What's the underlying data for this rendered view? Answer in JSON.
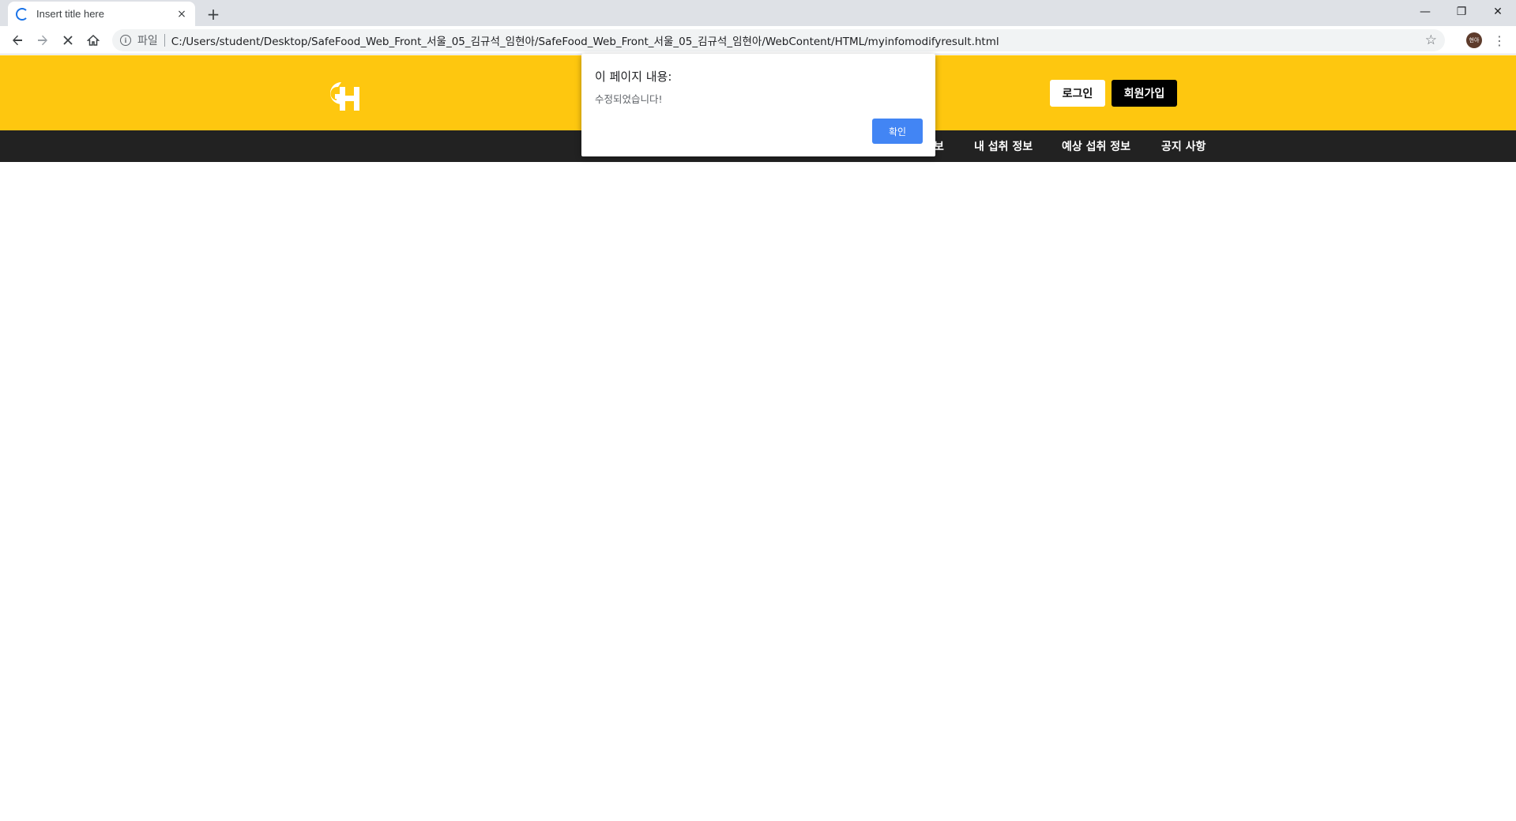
{
  "browser": {
    "tab_title": "Insert title here",
    "tab_close": "×",
    "new_tab": "+",
    "window_controls": {
      "minimize": "—",
      "restore": "❐",
      "close": "✕"
    },
    "url_scheme_label": "파일",
    "url": "C:/Users/student/Desktop/SafeFood_Web_Front_서울_05_김규석_임현아/SafeFood_Web_Front_서울_05_김규석_임현아/WebContent/HTML/myinfomodifyresult.html",
    "avatar_text": "현아",
    "icons": {
      "back": "back-arrow-icon",
      "forward": "forward-arrow-icon",
      "stop": "stop-loading-icon",
      "home": "home-icon",
      "info": "info-icon",
      "star": "star-icon",
      "menu": "kebab-menu-icon"
    }
  },
  "site": {
    "brand_color": "#fec70f",
    "nav_color": "#222222",
    "logo_text": "GH",
    "login_label": "로그인",
    "signup_label": "회원가입",
    "nav_items": [
      {
        "label": "보"
      },
      {
        "label": "내 섭취 정보"
      },
      {
        "label": "예상 섭취 정보"
      },
      {
        "label": "공지 사항"
      }
    ]
  },
  "alert": {
    "title": "이 페이지 내용:",
    "message": "수정되었습니다!",
    "ok_label": "확인",
    "ok_color": "#4285f4"
  }
}
